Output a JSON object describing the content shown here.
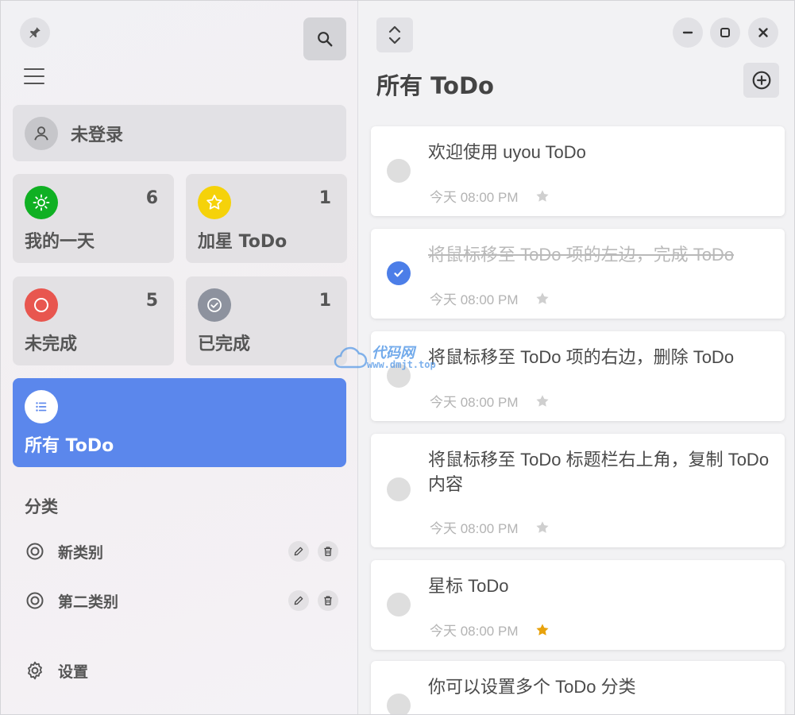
{
  "sidebar": {
    "user_label": "未登录",
    "tiles": {
      "my_day": {
        "label": "我的一天",
        "count": "6",
        "color": "#10b023"
      },
      "starred": {
        "label": "加星 ToDo",
        "count": "1",
        "color": "#f5d20a"
      },
      "incomplete": {
        "label": "未完成",
        "count": "5",
        "color": "#e8564f"
      },
      "completed": {
        "label": "已完成",
        "count": "1",
        "color": "#8d929e"
      },
      "all": {
        "label": "所有 ToDo",
        "color": "#5b87ec"
      }
    },
    "categories_title": "分类",
    "categories": [
      {
        "label": "新类别"
      },
      {
        "label": "第二类别"
      }
    ],
    "settings_label": "设置"
  },
  "main": {
    "title": "所有 ToDo",
    "todos": [
      {
        "title": "欢迎使用 uyou ToDo",
        "time": "今天 08:00 PM",
        "done": false,
        "starred": false
      },
      {
        "title": "将鼠标移至 ToDo 项的左边，完成 ToDo",
        "time": "今天 08:00 PM",
        "done": true,
        "starred": false
      },
      {
        "title": "将鼠标移至 ToDo 项的右边，删除 ToDo",
        "time": "今天 08:00 PM",
        "done": false,
        "starred": false
      },
      {
        "title": "将鼠标移至 ToDo 标题栏右上角，复制 ToDo 内容",
        "time": "今天 08:00 PM",
        "done": false,
        "starred": false
      },
      {
        "title": "星标 ToDo",
        "time": "今天 08:00 PM",
        "done": false,
        "starred": true
      },
      {
        "title": "你可以设置多个 ToDo 分类",
        "time": "",
        "done": false,
        "starred": false
      }
    ]
  },
  "watermark": {
    "title": "代码网",
    "url": "www.dmjt.top"
  },
  "colors": {
    "accent": "#5b87ec",
    "check_done": "#4c7ee8",
    "star_on": "#e8a20c",
    "star_off": "#cfcfcf"
  }
}
